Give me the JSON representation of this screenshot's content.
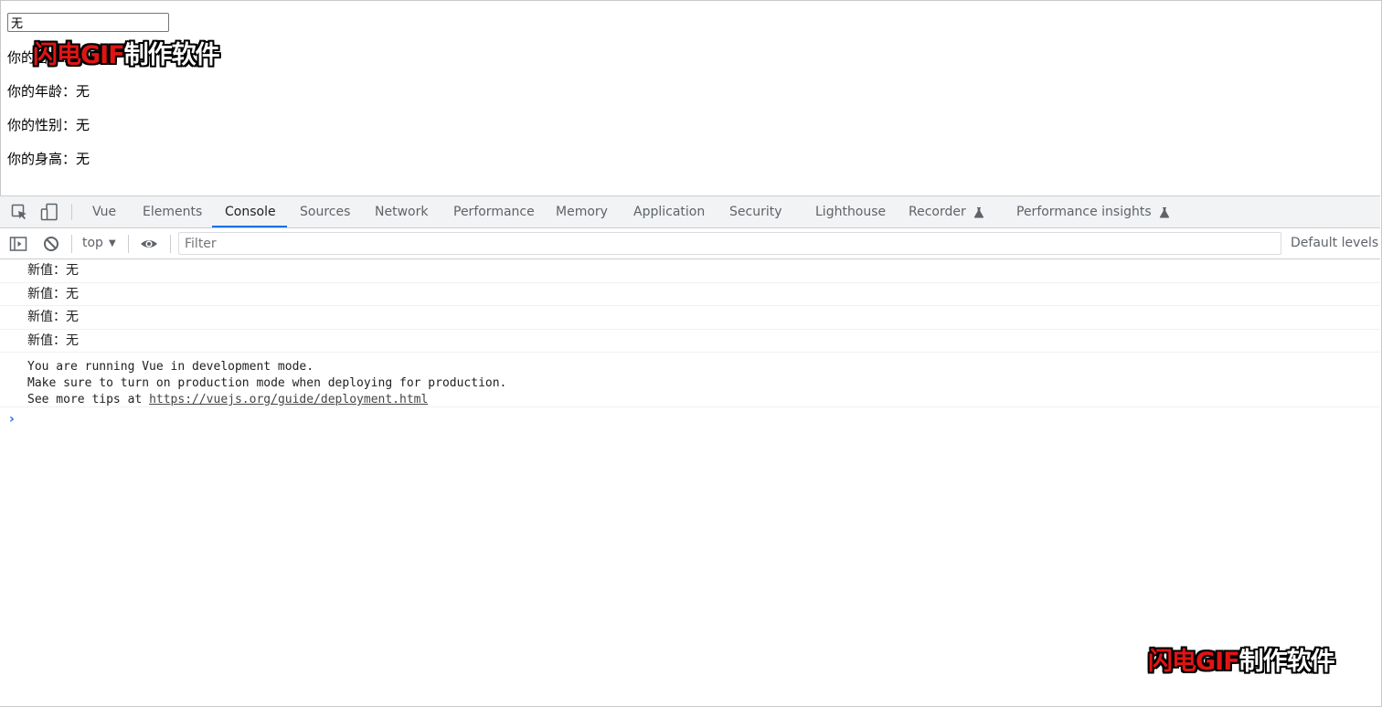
{
  "page": {
    "input_value": "无",
    "lines": [
      "你的名字：无",
      "你的年龄：无",
      "你的性别：无",
      "你的身高：无"
    ]
  },
  "watermark": {
    "red_part": "闪电GIF",
    "white_part": "制作软件"
  },
  "devtools": {
    "tabs": [
      {
        "label": "Vue"
      },
      {
        "label": "Elements"
      },
      {
        "label": "Console"
      },
      {
        "label": "Sources"
      },
      {
        "label": "Network"
      },
      {
        "label": "Performance"
      },
      {
        "label": "Memory"
      },
      {
        "label": "Application"
      },
      {
        "label": "Security"
      },
      {
        "label": "Lighthouse"
      },
      {
        "label": "Recorder"
      },
      {
        "label": "Performance insights"
      }
    ],
    "active_tab": "Console",
    "toolbar": {
      "context": "top",
      "filter_placeholder": "Filter",
      "levels": "Default levels"
    },
    "console": {
      "messages": [
        "新值：无",
        "新值：无",
        "新值：无",
        "新值：无"
      ],
      "vue_notice": {
        "line1": "You are running Vue in development mode.",
        "line2": "Make sure to turn on production mode when deploying for production.",
        "line3_prefix": "See more tips at ",
        "line3_link": "https://vuejs.org/guide/deployment.html"
      },
      "prompt": "›"
    },
    "accent_color": "#1a73e8"
  }
}
